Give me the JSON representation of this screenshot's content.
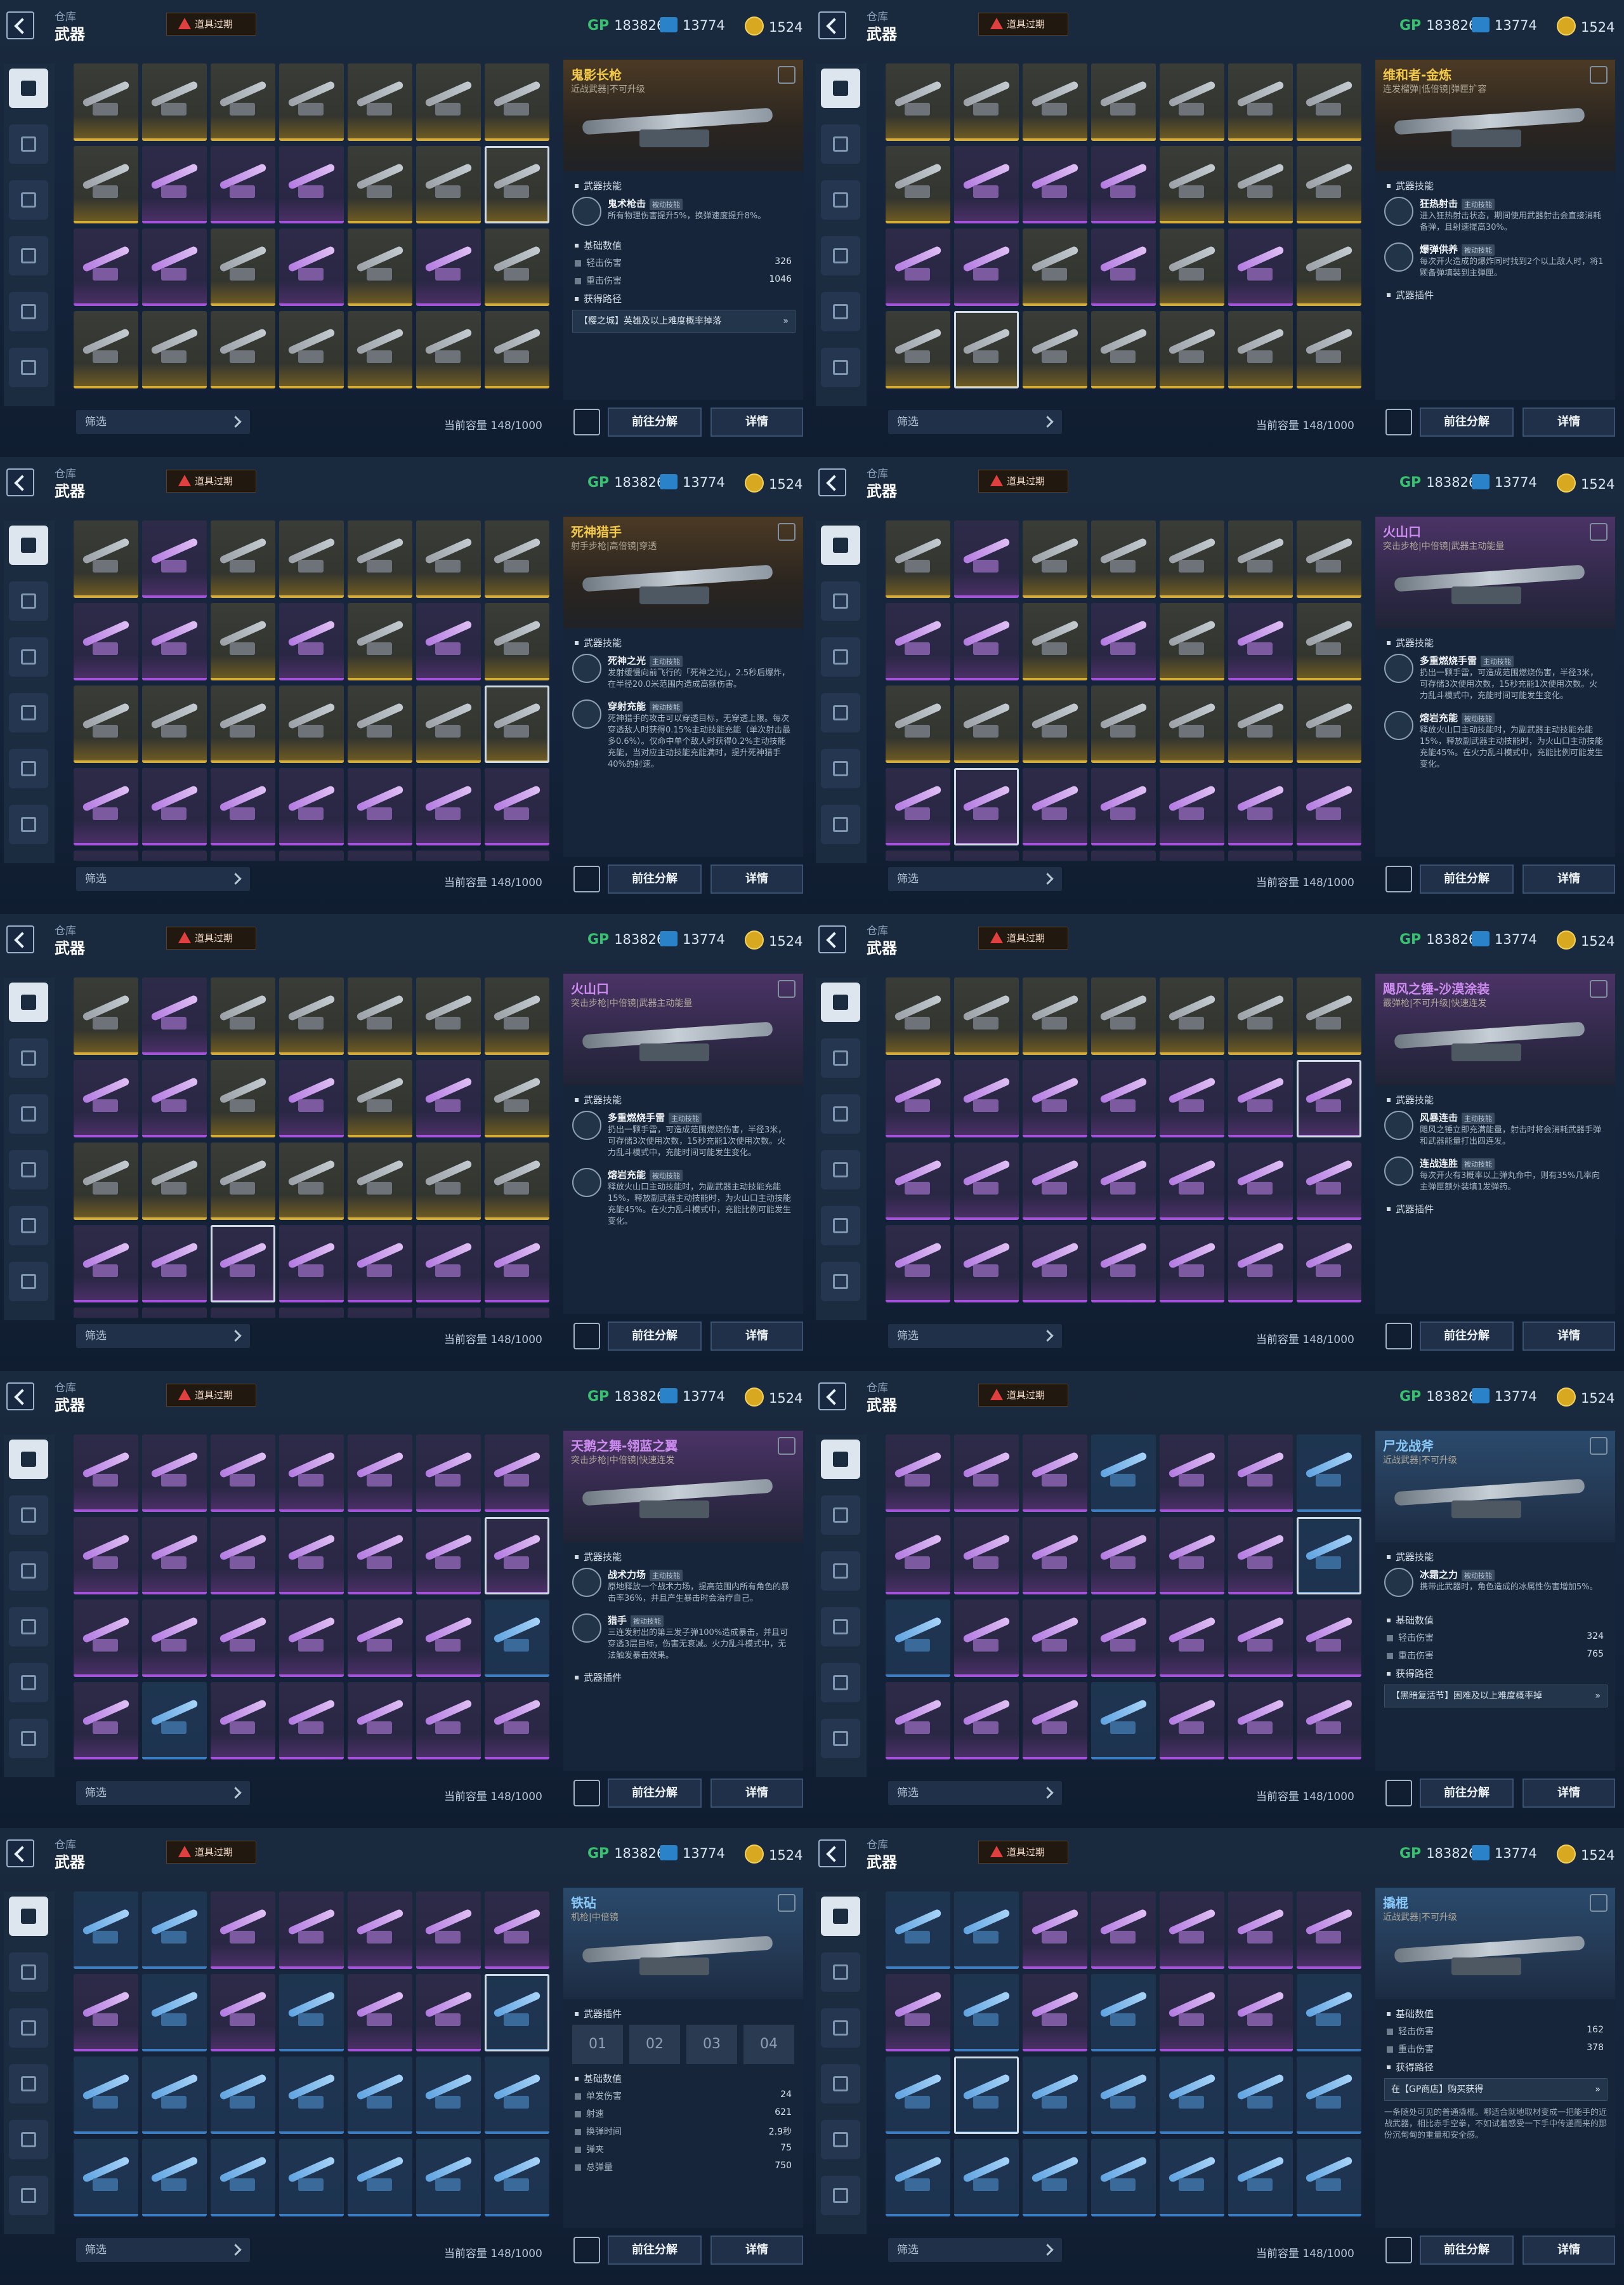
{
  "common": {
    "crumb": "仓库",
    "title": "武器",
    "expire_label": "道具过期",
    "gp_label": "GP",
    "gp_value": "183826",
    "ticket_value": "13774",
    "coin_value": "1524",
    "filter_label": "筛选",
    "capacity": "当前容量 148/1000",
    "decompose_label": "前往分解",
    "detail_label": "详情"
  },
  "panels": [
    {
      "rarity": "gold",
      "name": "鬼影长枪",
      "type": "近战武器|不可升级",
      "sections": [
        {
          "kind": "title",
          "label": "武器技能"
        },
        {
          "kind": "skill",
          "name": "鬼术枪击",
          "tag": "被动技能",
          "desc": "所有物理伤害提升5%，换弹速度提升8%。"
        },
        {
          "kind": "title",
          "label": "基础数值"
        },
        {
          "kind": "stat",
          "label": "轻击伤害",
          "value": "326"
        },
        {
          "kind": "stat",
          "label": "重击伤害",
          "value": "1046"
        },
        {
          "kind": "title",
          "label": "获得路径"
        },
        {
          "kind": "src",
          "text": "【樱之城】英雄及以上难度概率掉落"
        }
      ],
      "cells": [
        "g",
        "g",
        "g",
        "g",
        "g",
        "g",
        "g",
        "g",
        "p",
        "p",
        "p",
        "gL",
        "g",
        "gS",
        "p",
        "pW",
        "g",
        "p",
        "gs",
        "p",
        "g",
        "g",
        "g",
        "g",
        "gL",
        "gY",
        "gY",
        "g"
      ]
    },
    {
      "rarity": "gold",
      "name": "维和者-金炼",
      "type": "连发榴弹|低倍镜|弹匣扩容",
      "sections": [
        {
          "kind": "title",
          "label": "武器技能"
        },
        {
          "kind": "skill",
          "name": "狂热射击",
          "tag": "主动技能",
          "desc": "进入狂热射击状态，期间使用武器射击会直接消耗备弹，且射速提高30%。"
        },
        {
          "kind": "skill",
          "name": "爆弹供养",
          "tag": "被动技能",
          "desc": "每次开火造成的爆炸同时找到2个以上敌人时，将1颗备弹填装到主弹匣。"
        },
        {
          "kind": "title",
          "label": "武器插件"
        }
      ],
      "cells": [
        "g",
        "g",
        "g",
        "g",
        "g",
        "g",
        "g",
        "g",
        "p",
        "p",
        "p",
        "gL",
        "g",
        "g",
        "p",
        "pW",
        "g",
        "p",
        "gs",
        "p",
        "g",
        "g",
        "gS",
        "g",
        "gL",
        "gY",
        "gY",
        "g"
      ]
    },
    {
      "rarity": "gold",
      "name": "死神猎手",
      "type": "射手步枪|高倍镜|穿透",
      "sections": [
        {
          "kind": "title",
          "label": "武器技能"
        },
        {
          "kind": "skill",
          "name": "死神之光",
          "tag": "主动技能",
          "desc": "发射缓慢向前飞行的「死神之光」，2.5秒后爆炸，在半径20.0米范围内造成高额伤害。"
        },
        {
          "kind": "skill",
          "name": "穿射充能",
          "tag": "被动技能",
          "desc": "死神猎手的攻击可以穿透目标，无穿透上限。每次穿透敌人时获得0.15%主动技能充能（单次射击最多0.6%）。仅命中单个敌人时获得0.2%主动技能充能，当对应主动技能充能满时，提升死神猎手40%的射速。"
        }
      ],
      "cells": [
        "g",
        "p",
        "g",
        "g",
        "gL",
        "g",
        "g",
        "p",
        "pW",
        "g",
        "p",
        "gs",
        "p",
        "g",
        "g",
        "g",
        "g",
        "gL",
        "gY",
        "gY",
        "gS",
        "p",
        "p",
        "p",
        "p",
        "p",
        "p",
        "p",
        "p",
        "p",
        "p",
        "p",
        "p",
        "p",
        "p"
      ]
    },
    {
      "rarity": "purple",
      "name": "火山口",
      "type": "突击步枪|中倍镜|武器主动能量",
      "sections": [
        {
          "kind": "title",
          "label": "武器技能"
        },
        {
          "kind": "skill",
          "name": "多重燃烧手雷",
          "tag": "主动技能",
          "desc": "扔出一颗手雷，可造成范围燃烧伤害，半径3米，可存储3次使用次数，15秒充能1次使用次数。火力乱斗模式中，充能时间可能发生变化。"
        },
        {
          "kind": "skill",
          "name": "熔岩充能",
          "tag": "被动技能",
          "desc": "释放火山口主动技能时，为副武器主动技能充能15%，释放副武器主动技能时，为火山口主动技能充能45%。在火力乱斗模式中，充能比例可能发生变化。"
        }
      ],
      "cells": [
        "g",
        "p",
        "g",
        "g",
        "gL",
        "g",
        "g",
        "p",
        "pW",
        "g",
        "p",
        "gs",
        "p",
        "g",
        "g",
        "g",
        "g",
        "gL",
        "gY",
        "gY",
        "g",
        "p",
        "pS",
        "p",
        "p",
        "p",
        "p",
        "p",
        "p",
        "p",
        "p",
        "p",
        "p",
        "p",
        "p"
      ]
    },
    {
      "rarity": "purple",
      "name": "火山口",
      "type": "突击步枪|中倍镜|武器主动能量",
      "sections": [
        {
          "kind": "title",
          "label": "武器技能"
        },
        {
          "kind": "skill",
          "name": "多重燃烧手雷",
          "tag": "主动技能",
          "desc": "扔出一颗手雷，可造成范围燃烧伤害，半径3米，可存储3次使用次数，15秒充能1次使用次数。火力乱斗模式中，充能时间可能发生变化。"
        },
        {
          "kind": "skill",
          "name": "熔岩充能",
          "tag": "被动技能",
          "desc": "释放火山口主动技能时，为副武器主动技能充能15%，释放副武器主动技能时，为火山口主动技能充能45%。在火力乱斗模式中，充能比例可能发生变化。"
        }
      ],
      "cells": [
        "g",
        "p",
        "g",
        "g",
        "gL",
        "g",
        "g",
        "p",
        "pW",
        "g",
        "p",
        "gs",
        "p",
        "g",
        "g",
        "g",
        "g",
        "gL",
        "gY",
        "gY",
        "g",
        "p",
        "p",
        "pS",
        "p",
        "p",
        "p",
        "p",
        "p",
        "p",
        "p",
        "p",
        "p",
        "p",
        "p"
      ]
    },
    {
      "rarity": "purple",
      "name": "飓风之锤-沙漠涂装",
      "type": "霰弹枪|不可升级|快速连发",
      "sections": [
        {
          "kind": "title",
          "label": "武器技能"
        },
        {
          "kind": "skill",
          "name": "风暴连击",
          "tag": "主动技能",
          "desc": "飓风之锤立即充满能量，射击时将会消耗武器手弹和武器能量打出四连发。"
        },
        {
          "kind": "skill",
          "name": "连战连胜",
          "tag": "被动技能",
          "desc": "每次开火有3概率以上弹丸命中，则有35%几率向主弹匣额外装填1发弹药。"
        },
        {
          "kind": "title",
          "label": "武器插件"
        }
      ],
      "cells": [
        "g",
        "g",
        "g",
        "gL",
        "gY",
        "gY",
        "g",
        "p",
        "p",
        "p",
        "p",
        "p",
        "p",
        "pS",
        "p",
        "p",
        "p",
        "p",
        "p",
        "p",
        "p",
        "p",
        "p",
        "p",
        "p",
        "p",
        "p",
        "p"
      ]
    },
    {
      "rarity": "purple",
      "name": "天鹅之舞-翎蓝之翼",
      "type": "突击步枪|中倍镜|快速连发",
      "sections": [
        {
          "kind": "title",
          "label": "武器技能"
        },
        {
          "kind": "skill",
          "name": "战术力场",
          "tag": "主动技能",
          "desc": "原地释放一个战术力场，提高范围内所有角色的暴击率36%，并且产生暴击时会治疗自己。"
        },
        {
          "kind": "skill",
          "name": "猎手",
          "tag": "被动技能",
          "desc": "三连发射出的第三发子弹100%造成暴击，并且可穿透3层目标，伤害无衰减。火力乱斗模式中，无法触发暴击效果。"
        },
        {
          "kind": "title",
          "label": "武器插件"
        }
      ],
      "cells": [
        "p",
        "p",
        "p",
        "p",
        "p",
        "p",
        "p",
        "p",
        "p",
        "p",
        "p",
        "p",
        "p",
        "pS",
        "p",
        "p",
        "p",
        "p",
        "p",
        "p",
        "b",
        "p",
        "b",
        "p",
        "p",
        "p",
        "p",
        "p"
      ]
    },
    {
      "rarity": "blue",
      "name": "尸龙战斧",
      "type": "近战武器|不可升级",
      "sections": [
        {
          "kind": "title",
          "label": "武器技能"
        },
        {
          "kind": "skill",
          "name": "冰霜之力",
          "tag": "被动技能",
          "desc": "携带此武器时，角色造成的冰属性伤害增加5%。"
        },
        {
          "kind": "title",
          "label": "基础数值"
        },
        {
          "kind": "stat",
          "label": "轻击伤害",
          "value": "324"
        },
        {
          "kind": "stat",
          "label": "重击伤害",
          "value": "765"
        },
        {
          "kind": "title",
          "label": "获得路径"
        },
        {
          "kind": "src",
          "text": "【黑暗复活节】困难及以上难度概率掉"
        }
      ],
      "cells": [
        "p",
        "p",
        "p",
        "b",
        "p",
        "p",
        "b",
        "p",
        "p",
        "p",
        "p",
        "p",
        "p",
        "bS",
        "b",
        "p",
        "p",
        "p",
        "p",
        "p",
        "p",
        "p",
        "p",
        "pL",
        "b",
        "p",
        "p",
        "p"
      ]
    },
    {
      "rarity": "blue",
      "name": "铁砧",
      "type": "机枪|中倍镜",
      "sections": [
        {
          "kind": "title",
          "label": "武器插件"
        },
        {
          "kind": "slots",
          "values": [
            "01",
            "02",
            "03",
            "04"
          ]
        },
        {
          "kind": "title",
          "label": "基础数值"
        },
        {
          "kind": "stat",
          "label": "单发伤害",
          "value": "24"
        },
        {
          "kind": "stat",
          "label": "射速",
          "value": "621"
        },
        {
          "kind": "stat",
          "label": "换弹时间",
          "value": "2.9秒"
        },
        {
          "kind": "stat",
          "label": "弹夹",
          "value": "75"
        },
        {
          "kind": "stat",
          "label": "总弹量",
          "value": "750"
        }
      ],
      "cells": [
        "b",
        "b",
        "p",
        "p",
        "p",
        "p",
        "p",
        "p",
        "b",
        "pL",
        "b",
        "p",
        "p",
        "bS",
        "b",
        "b",
        "b",
        "b",
        "b",
        "b",
        "b",
        "b",
        "b",
        "b",
        "b",
        "b",
        "b",
        "b"
      ]
    },
    {
      "rarity": "blue",
      "name": "撬棍",
      "type": "近战武器|不可升级",
      "sections": [
        {
          "kind": "title",
          "label": "基础数值"
        },
        {
          "kind": "stat",
          "label": "轻击伤害",
          "value": "162"
        },
        {
          "kind": "stat",
          "label": "重击伤害",
          "value": "378"
        },
        {
          "kind": "title",
          "label": "获得路径"
        },
        {
          "kind": "src",
          "text": "在【GP商店】购买获得"
        },
        {
          "kind": "note",
          "text": "一条随处可见的普通撬棍。哪适合就地取材变成一把能手的近战武器，相比赤手空拳，不如试着感受一下手中传递而来的那份沉甸甸的重量和安全感。"
        }
      ],
      "cells": [
        "b",
        "b",
        "p",
        "p",
        "p",
        "p",
        "p",
        "p",
        "b",
        "pL",
        "b",
        "p",
        "p",
        "b",
        "b",
        "bS",
        "b",
        "b",
        "b",
        "b",
        "b",
        "b",
        "b",
        "b",
        "b",
        "b",
        "b",
        "b"
      ]
    }
  ]
}
